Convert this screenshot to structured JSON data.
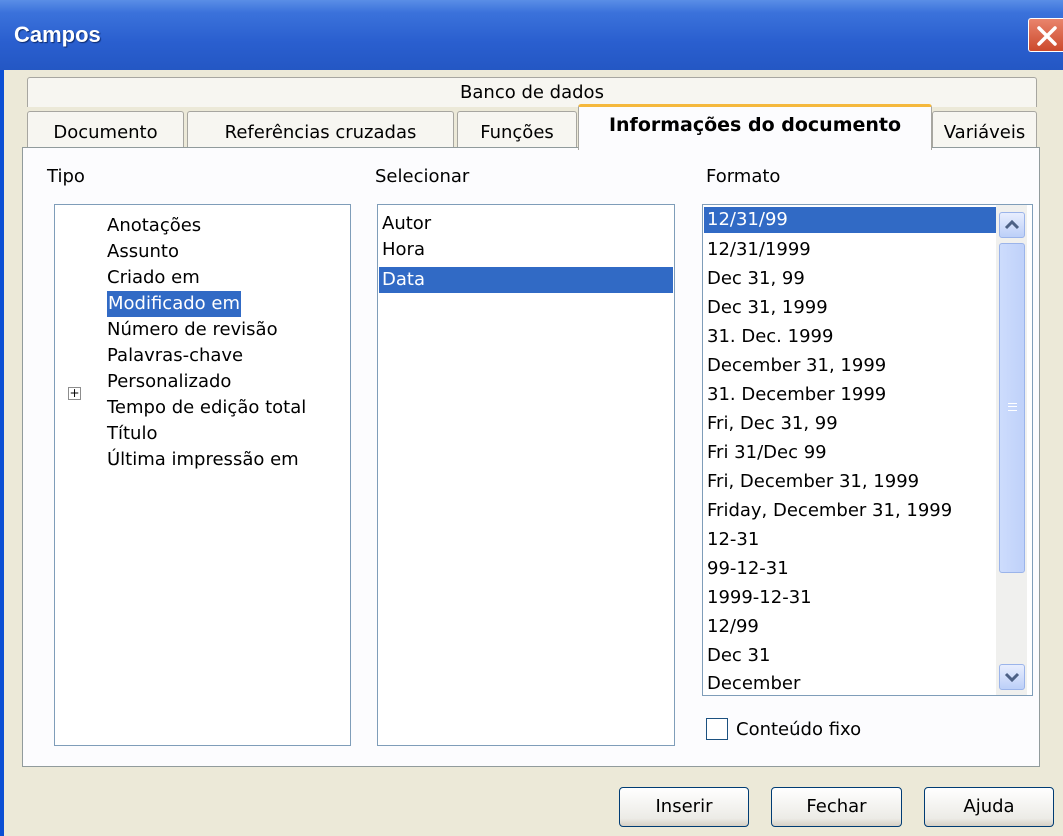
{
  "window": {
    "title": "Campos"
  },
  "tabs": {
    "row1": [
      "Banco de dados"
    ],
    "row2": [
      "Documento",
      "Referências cruzadas",
      "Funções",
      "Informações do documento",
      "Variáveis"
    ],
    "active": "Informações do documento"
  },
  "tipo": {
    "label": "Tipo",
    "items": [
      "Anotações",
      "Assunto",
      "Criado em",
      "Modificado em",
      "Número de revisão",
      "Palavras-chave",
      "Personalizado",
      "Tempo de edição total",
      "Título",
      "Última impressão em"
    ],
    "selected": "Modificado em",
    "expander": "+"
  },
  "selecionar": {
    "label": "Selecionar",
    "items": [
      "Autor",
      "Hora",
      "Data"
    ],
    "selected": "Data"
  },
  "formato": {
    "label": "Formato",
    "items": [
      "12/31/99",
      "12/31/1999",
      "Dec 31, 99",
      "Dec 31, 1999",
      "31. Dec. 1999",
      "December 31, 1999",
      "31. December 1999",
      "Fri, Dec 31, 99",
      "Fri 31/Dec 99",
      "Fri, December 31, 1999",
      "Friday, December 31, 1999",
      "12-31",
      "99-12-31",
      "1999-12-31",
      "12/99",
      "Dec 31",
      "December"
    ],
    "selected": "12/31/99"
  },
  "fixed_content": {
    "label": "Conteúdo fixo",
    "checked": false
  },
  "buttons": {
    "insert": "Inserir",
    "close": "Fechar",
    "help": "Ajuda"
  },
  "icons": {
    "close": "close-icon",
    "expander": "plus-icon",
    "scroll_up": "chevron-up-icon",
    "scroll_down": "chevron-down-icon"
  },
  "colors": {
    "titlebar": "#2a5fcf",
    "selection": "#316ac5",
    "active_tab_accent": "#f5b83c",
    "close_button": "#cc4a2c"
  }
}
